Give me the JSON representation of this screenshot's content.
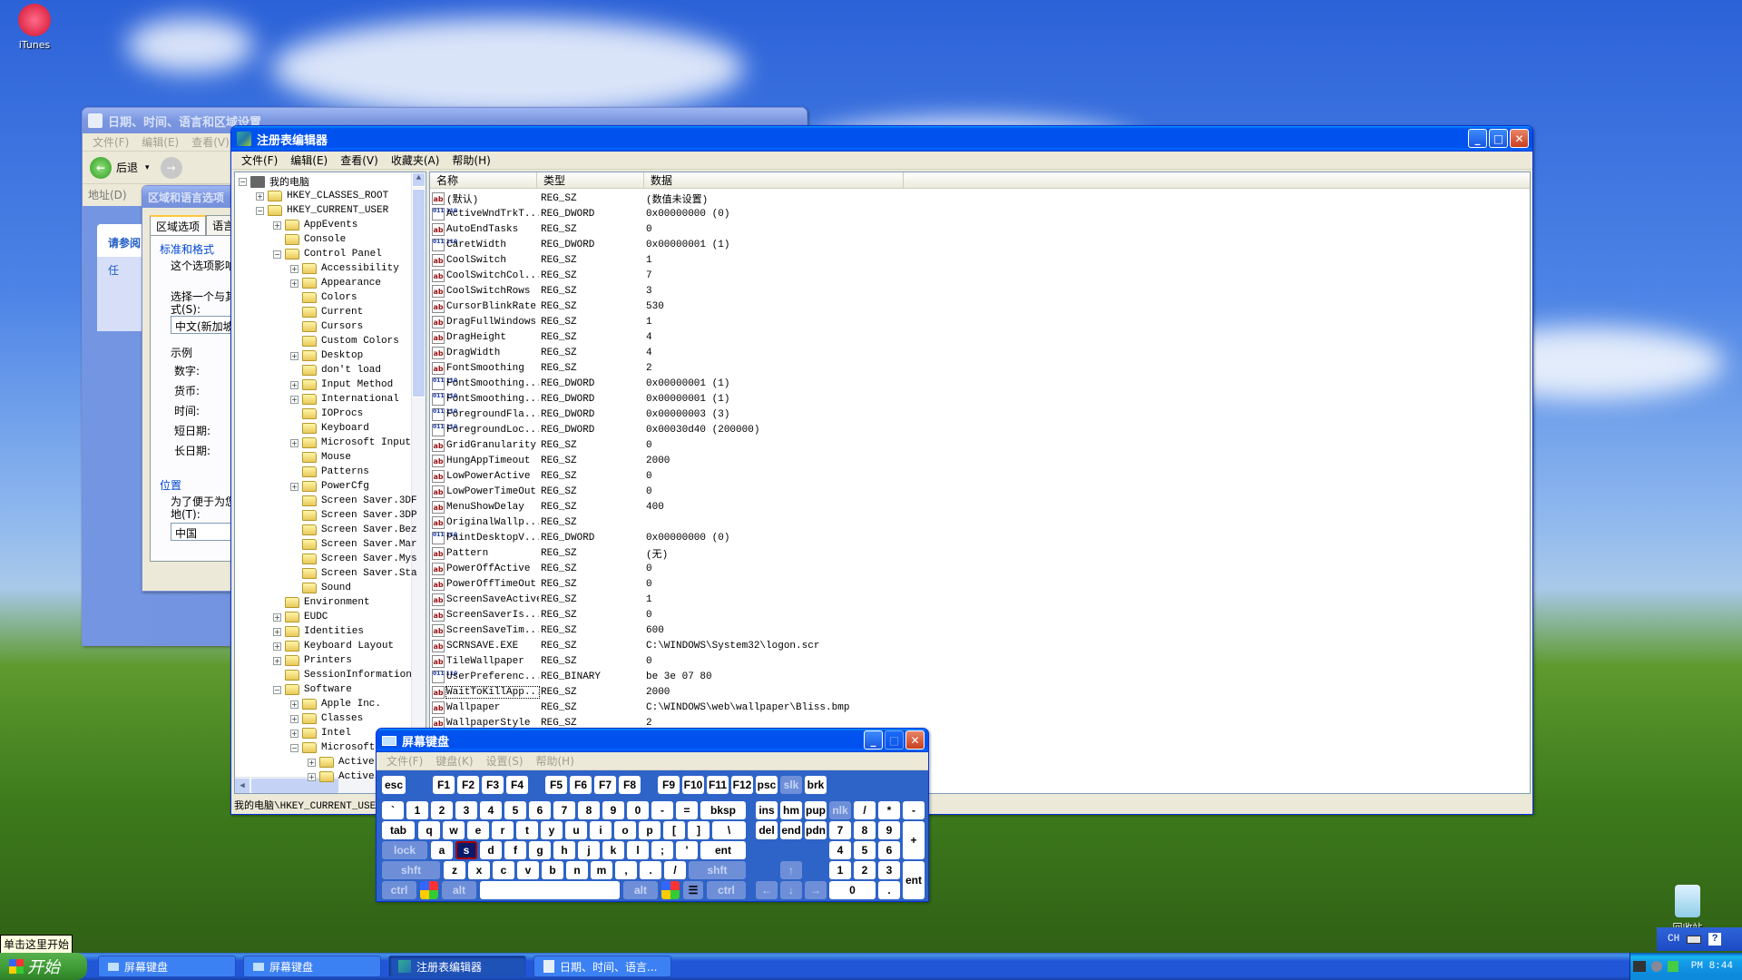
{
  "desktop": {
    "icons": [
      {
        "label": "iTunes",
        "icon": "itunes-icon"
      },
      {
        "label": "回收站",
        "icon": "recycle-bin-icon"
      }
    ]
  },
  "datetime_window": {
    "title": "日期、时间、语言和区域设置",
    "menu": [
      "文件(F)",
      "编辑(E)",
      "查看(V)"
    ],
    "back_label": "后退",
    "address_label": "地址(D)",
    "side_heading": "请参阅",
    "side_item": "任"
  },
  "region_dialog": {
    "title": "区域和语言选项",
    "tabs": [
      "区域选项",
      "语言"
    ],
    "group_format": "标准和格式",
    "format_desc": "这个选项影响",
    "select_label": "选择一个与其",
    "select_label2": "式(S):",
    "format_value": "中文(新加坡",
    "sample_label": "示例",
    "sample_rows": [
      "数字:",
      "货币:",
      "时间:",
      "短日期:",
      "长日期:"
    ],
    "group_location": "位置",
    "location_desc": "为了便于为您",
    "location_label": "地(T):",
    "location_value": "中国"
  },
  "regedit": {
    "title": "注册表编辑器",
    "menu": [
      "文件(F)",
      "编辑(E)",
      "查看(V)",
      "收藏夹(A)",
      "帮助(H)"
    ],
    "tree": [
      {
        "label": "我的电脑",
        "level": 0,
        "exp": "-",
        "icon": "computer"
      },
      {
        "label": "HKEY_CLASSES_ROOT",
        "level": 1,
        "exp": "+"
      },
      {
        "label": "HKEY_CURRENT_USER",
        "level": 1,
        "exp": "-"
      },
      {
        "label": "AppEvents",
        "level": 2,
        "exp": "+"
      },
      {
        "label": "Console",
        "level": 2,
        "exp": ""
      },
      {
        "label": "Control Panel",
        "level": 2,
        "exp": "-"
      },
      {
        "label": "Accessibility",
        "level": 3,
        "exp": "+"
      },
      {
        "label": "Appearance",
        "level": 3,
        "exp": "+"
      },
      {
        "label": "Colors",
        "level": 3,
        "exp": ""
      },
      {
        "label": "Current",
        "level": 3,
        "exp": ""
      },
      {
        "label": "Cursors",
        "level": 3,
        "exp": ""
      },
      {
        "label": "Custom Colors",
        "level": 3,
        "exp": ""
      },
      {
        "label": "Desktop",
        "level": 3,
        "exp": "+",
        "open": true
      },
      {
        "label": "don't load",
        "level": 3,
        "exp": ""
      },
      {
        "label": "Input Method",
        "level": 3,
        "exp": "+"
      },
      {
        "label": "International",
        "level": 3,
        "exp": "+"
      },
      {
        "label": "IOProcs",
        "level": 3,
        "exp": ""
      },
      {
        "label": "Keyboard",
        "level": 3,
        "exp": ""
      },
      {
        "label": "Microsoft Input",
        "level": 3,
        "exp": "+"
      },
      {
        "label": "Mouse",
        "level": 3,
        "exp": ""
      },
      {
        "label": "Patterns",
        "level": 3,
        "exp": ""
      },
      {
        "label": "PowerCfg",
        "level": 3,
        "exp": "+"
      },
      {
        "label": "Screen Saver.3DF",
        "level": 3,
        "exp": ""
      },
      {
        "label": "Screen Saver.3DP",
        "level": 3,
        "exp": ""
      },
      {
        "label": "Screen Saver.Bez",
        "level": 3,
        "exp": ""
      },
      {
        "label": "Screen Saver.Mar",
        "level": 3,
        "exp": ""
      },
      {
        "label": "Screen Saver.Mys",
        "level": 3,
        "exp": ""
      },
      {
        "label": "Screen Saver.Sta",
        "level": 3,
        "exp": ""
      },
      {
        "label": "Sound",
        "level": 3,
        "exp": ""
      },
      {
        "label": "Environment",
        "level": 2,
        "exp": ""
      },
      {
        "label": "EUDC",
        "level": 2,
        "exp": "+"
      },
      {
        "label": "Identities",
        "level": 2,
        "exp": "+"
      },
      {
        "label": "Keyboard Layout",
        "level": 2,
        "exp": "+"
      },
      {
        "label": "Printers",
        "level": 2,
        "exp": "+"
      },
      {
        "label": "SessionInformation",
        "level": 2,
        "exp": ""
      },
      {
        "label": "Software",
        "level": 2,
        "exp": "-"
      },
      {
        "label": "Apple Inc.",
        "level": 3,
        "exp": "+"
      },
      {
        "label": "Classes",
        "level": 3,
        "exp": "+"
      },
      {
        "label": "Intel",
        "level": 3,
        "exp": "+"
      },
      {
        "label": "Microsoft",
        "level": 3,
        "exp": "-"
      },
      {
        "label": "Active",
        "level": 4,
        "exp": "+"
      },
      {
        "label": "Active",
        "level": 4,
        "exp": "+"
      }
    ],
    "columns": [
      "名称",
      "类型",
      "数据"
    ],
    "values": [
      {
        "name": "(默认)",
        "type": "REG_SZ",
        "data": "(数值未设置)",
        "kind": "sz"
      },
      {
        "name": "ActiveWndTrkT...",
        "type": "REG_DWORD",
        "data": "0x00000000 (0)",
        "kind": "bin"
      },
      {
        "name": "AutoEndTasks",
        "type": "REG_SZ",
        "data": "0",
        "kind": "sz"
      },
      {
        "name": "CaretWidth",
        "type": "REG_DWORD",
        "data": "0x00000001 (1)",
        "kind": "bin"
      },
      {
        "name": "CoolSwitch",
        "type": "REG_SZ",
        "data": "1",
        "kind": "sz"
      },
      {
        "name": "CoolSwitchCol...",
        "type": "REG_SZ",
        "data": "7",
        "kind": "sz"
      },
      {
        "name": "CoolSwitchRows",
        "type": "REG_SZ",
        "data": "3",
        "kind": "sz"
      },
      {
        "name": "CursorBlinkRate",
        "type": "REG_SZ",
        "data": "530",
        "kind": "sz"
      },
      {
        "name": "DragFullWindows",
        "type": "REG_SZ",
        "data": "1",
        "kind": "sz"
      },
      {
        "name": "DragHeight",
        "type": "REG_SZ",
        "data": "4",
        "kind": "sz"
      },
      {
        "name": "DragWidth",
        "type": "REG_SZ",
        "data": "4",
        "kind": "sz"
      },
      {
        "name": "FontSmoothing",
        "type": "REG_SZ",
        "data": "2",
        "kind": "sz"
      },
      {
        "name": "FontSmoothing...",
        "type": "REG_DWORD",
        "data": "0x00000001 (1)",
        "kind": "bin"
      },
      {
        "name": "FontSmoothing...",
        "type": "REG_DWORD",
        "data": "0x00000001 (1)",
        "kind": "bin"
      },
      {
        "name": "ForegroundFla...",
        "type": "REG_DWORD",
        "data": "0x00000003 (3)",
        "kind": "bin"
      },
      {
        "name": "ForegroundLoc...",
        "type": "REG_DWORD",
        "data": "0x00030d40 (200000)",
        "kind": "bin"
      },
      {
        "name": "GridGranularity",
        "type": "REG_SZ",
        "data": "0",
        "kind": "sz"
      },
      {
        "name": "HungAppTimeout",
        "type": "REG_SZ",
        "data": "2000",
        "kind": "sz"
      },
      {
        "name": "LowPowerActive",
        "type": "REG_SZ",
        "data": "0",
        "kind": "sz"
      },
      {
        "name": "LowPowerTimeOut",
        "type": "REG_SZ",
        "data": "0",
        "kind": "sz"
      },
      {
        "name": "MenuShowDelay",
        "type": "REG_SZ",
        "data": "400",
        "kind": "sz"
      },
      {
        "name": "OriginalWallp...",
        "type": "REG_SZ",
        "data": "",
        "kind": "sz"
      },
      {
        "name": "PaintDesktopV...",
        "type": "REG_DWORD",
        "data": "0x00000000 (0)",
        "kind": "bin"
      },
      {
        "name": "Pattern",
        "type": "REG_SZ",
        "data": "(无)",
        "kind": "sz"
      },
      {
        "name": "PowerOffActive",
        "type": "REG_SZ",
        "data": "0",
        "kind": "sz"
      },
      {
        "name": "PowerOffTimeOut",
        "type": "REG_SZ",
        "data": "0",
        "kind": "sz"
      },
      {
        "name": "ScreenSaveActive",
        "type": "REG_SZ",
        "data": "1",
        "kind": "sz"
      },
      {
        "name": "ScreenSaverIs...",
        "type": "REG_SZ",
        "data": "0",
        "kind": "sz"
      },
      {
        "name": "ScreenSaveTim...",
        "type": "REG_SZ",
        "data": "600",
        "kind": "sz"
      },
      {
        "name": "SCRNSAVE.EXE",
        "type": "REG_SZ",
        "data": "C:\\WINDOWS\\System32\\logon.scr",
        "kind": "sz"
      },
      {
        "name": "TileWallpaper",
        "type": "REG_SZ",
        "data": "0",
        "kind": "sz"
      },
      {
        "name": "UserPreferenc...",
        "type": "REG_BINARY",
        "data": "be 3e 07 80",
        "kind": "bin"
      },
      {
        "name": "WaitToKillApp...",
        "type": "REG_SZ",
        "data": "2000",
        "kind": "sz",
        "focused": true
      },
      {
        "name": "Wallpaper",
        "type": "REG_SZ",
        "data": "C:\\WINDOWS\\web\\wallpaper\\Bliss.bmp",
        "kind": "sz"
      },
      {
        "name": "WallpaperStyle",
        "type": "REG_SZ",
        "data": "2",
        "kind": "sz"
      }
    ],
    "status": "我的电脑\\HKEY_CURRENT_USER"
  },
  "osk": {
    "title": "屏幕键盘",
    "menu": [
      "文件(F)",
      "键盘(K)",
      "设置(S)",
      "帮助(H)"
    ],
    "selected_key": "s"
  },
  "taskbar": {
    "tooltip": "单击这里开始",
    "start_label": "开始",
    "tasks": [
      {
        "label": "屏幕键盘",
        "active": false
      },
      {
        "label": "屏幕键盘",
        "active": false
      },
      {
        "label": "注册表编辑器",
        "active": true
      },
      {
        "label": "日期、时间、语言...",
        "active": false
      }
    ],
    "language_bar": "CH",
    "clock": "PM 8:44"
  }
}
